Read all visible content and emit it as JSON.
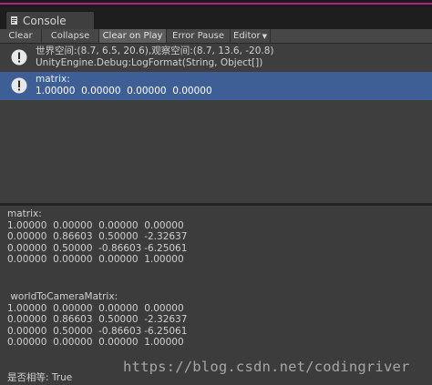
{
  "window": {
    "tab_title": "Console",
    "tab_icon": "console-icon"
  },
  "toolbar": {
    "clear": "Clear",
    "collapse": "Collapse",
    "clear_on_play": "Clear on Play",
    "error_pause": "Error Pause",
    "editor": "Editor"
  },
  "log_entries": [
    {
      "icon": "info-icon",
      "line1": "世界空间:(8.7, 6.5, 20.6),观察空间:(8.7, 13.6, -20.8)",
      "line2": "UnityEngine.Debug:LogFormat(String, Object[])",
      "selected": false
    },
    {
      "icon": "info-icon",
      "line1": "matrix:",
      "line2": "1.00000\t0.00000\t0.00000\t0.00000",
      "selected": true
    }
  ],
  "detail": {
    "block1": "matrix:\n1.00000\t0.00000\t0.00000\t0.00000\n0.00000\t0.86603\t0.50000\t-2.32637\n0.00000\t0.50000\t-0.86603\t-6.25061\n0.00000\t0.00000\t0.00000\t1.00000",
    "block2": " worldToCameraMatrix:\n1.00000\t0.00000\t0.00000\t0.00000\n0.00000\t0.86603\t0.50000\t-2.32637\n0.00000\t0.50000\t-0.86603\t-6.25061\n0.00000\t0.00000\t0.00000\t1.00000",
    "result": "是否相等: True"
  },
  "watermark": "https://blog.csdn.net/codingriver",
  "colors": {
    "selected_row": "#3e5f96",
    "background": "#3c3c3c",
    "accent_border": "#b5227d"
  }
}
